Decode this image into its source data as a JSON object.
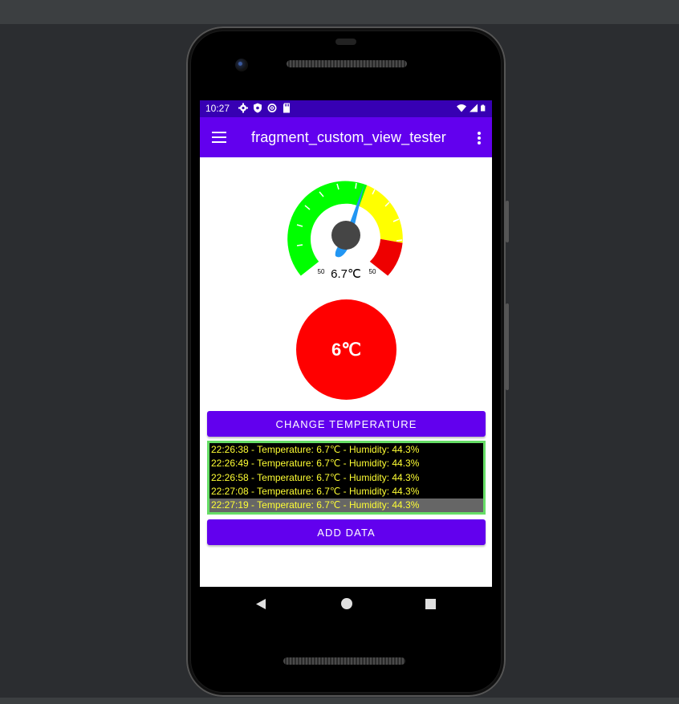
{
  "status_bar": {
    "time": "10:27",
    "left_icons": [
      "settings-icon",
      "shield-icon",
      "sync-icon",
      "sd-card-icon"
    ],
    "right_icons": [
      "wifi-icon",
      "signal-icon",
      "battery-icon"
    ]
  },
  "app_bar": {
    "title": "fragment_custom_view_tester",
    "menu_icon": "hamburger-menu-icon",
    "overflow_icon": "overflow-menu-icon",
    "color": "#6200ee"
  },
  "gauge": {
    "value_label": "6.7℃",
    "min_label": "50",
    "max_label": "50",
    "needle_value": 6.7,
    "zones": [
      {
        "name": "green",
        "color": "#00ff00"
      },
      {
        "name": "yellow",
        "color": "#ffff00"
      },
      {
        "name": "red",
        "color": "#ff0000"
      }
    ]
  },
  "round_view": {
    "label": "6℃",
    "color": "#ff0000"
  },
  "buttons": {
    "change_temperature": "CHANGE TEMPERATURE",
    "add_data": "ADD DATA"
  },
  "log": {
    "entries": [
      "22:26:38 - Temperature: 6.7℃ - Humidity: 44.3%",
      "22:26:49 - Temperature: 6.7℃ - Humidity: 44.3%",
      "22:26:58 - Temperature: 6.7℃ - Humidity: 44.3%",
      "22:27:08 - Temperature: 6.7℃ - Humidity: 44.3%",
      "22:27:19 - Temperature: 6.7℃ - Humidity: 44.3%"
    ],
    "selected_index": 4,
    "text_color": "#ffff33",
    "border_color": "#66dd66"
  },
  "nav_bar": {
    "icons": [
      "back-icon",
      "home-icon",
      "recent-apps-icon"
    ]
  }
}
